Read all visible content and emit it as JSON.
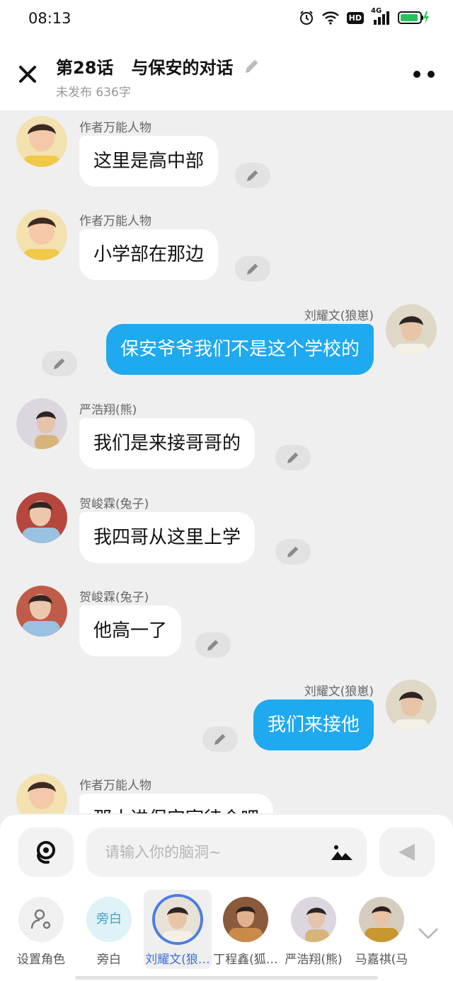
{
  "status_bar": {
    "time": "08:13",
    "network": "4G",
    "hd": "HD"
  },
  "header": {
    "title": "第28话   与保安的对话",
    "subtitle": "未发布 636字"
  },
  "messages": [
    {
      "side": "left",
      "name": "作者万能人物",
      "text": "这里是高中部",
      "avatar_colors": [
        "#f3e1b0",
        "#3a2a22",
        "#f4c8a8"
      ]
    },
    {
      "side": "left",
      "name": "作者万能人物",
      "text": "小学部在那边",
      "avatar_colors": [
        "#f3e1b0",
        "#3a2a22",
        "#f4c8a8"
      ]
    },
    {
      "side": "right",
      "name": "刘耀文(狼崽)",
      "text": "保安爷爷我们不是这个学校的",
      "avatar_colors": [
        "#e8e2d6",
        "#2c2522",
        "#e9c5a8"
      ]
    },
    {
      "side": "left",
      "name": "严浩翔(熊)",
      "text": "我们是来接哥哥的",
      "avatar_colors": [
        "#dcd6df",
        "#2b2424",
        "#e6c4ac"
      ]
    },
    {
      "side": "left",
      "name": "贺峻霖(兔子)",
      "text": "我四哥从这里上学",
      "avatar_colors": [
        "#b5473c",
        "#2f2522",
        "#9bc1e0"
      ]
    },
    {
      "side": "left",
      "name": "贺峻霖(兔子)",
      "text": "他高一了",
      "avatar_colors": [
        "#c05b47",
        "#2f2522",
        "#9bc1e0"
      ]
    },
    {
      "side": "right",
      "name": "刘耀文(狼崽)",
      "text": "我们来接他",
      "avatar_colors": [
        "#e8e2d6",
        "#2c2522",
        "#e9c5a8"
      ]
    },
    {
      "side": "left",
      "name": "作者万能人物",
      "text": "那小进保安室待会吧",
      "avatar_colors": [
        "#f3e1b0",
        "#3a2a22",
        "#f4c8a8"
      ]
    }
  ],
  "input": {
    "placeholder": "请输入你的脑洞~",
    "value": ""
  },
  "roles": [
    {
      "label": "设置角色",
      "kind": "set"
    },
    {
      "label": "旁白",
      "kind": "narrator",
      "badge": "旁白"
    },
    {
      "label": "刘耀文(狼…",
      "kind": "avatar",
      "active": true,
      "avatar_colors": [
        "#e8e2d6",
        "#2c2522",
        "#e9c5a8"
      ]
    },
    {
      "label": "丁程鑫(狐…",
      "kind": "avatar",
      "avatar_colors": [
        "#8a5a3a",
        "#2b211d",
        "#e2b28e"
      ]
    },
    {
      "label": "严浩翔(熊)",
      "kind": "avatar",
      "avatar_colors": [
        "#dcd6df",
        "#2b2424",
        "#e6c4ac"
      ]
    },
    {
      "label": "马嘉祺(马",
      "kind": "avatar",
      "avatar_colors": [
        "#d7cdbf",
        "#2b2120",
        "#c9962f"
      ]
    }
  ],
  "colors": {
    "accent_blue": "#1fa9ef",
    "active_ring": "#4a7fe0",
    "chat_bg": "#efefef"
  },
  "icons": [
    "close-icon",
    "pencil-icon",
    "more-icon",
    "voice-icon",
    "image-icon",
    "send-icon",
    "add-role-icon",
    "chevron-down-icon"
  ]
}
